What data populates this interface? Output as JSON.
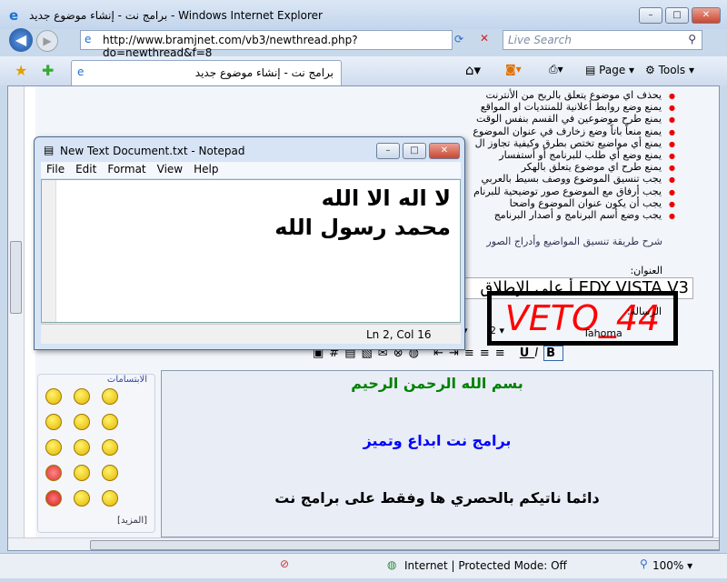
{
  "window": {
    "title": "برامج نت - إنشاء موضوع جديد - Windows Internet Explorer"
  },
  "nav": {
    "url": "http://www.bramjnet.com/vb3/newthread.php?do=newthread&f=8",
    "search_placeholder": "Live Search"
  },
  "tab": {
    "label": "برامج نت - إنشاء موضوع جديد"
  },
  "commands": {
    "page": "Page",
    "tools": "Tools"
  },
  "rules": [
    "يحذف اي موضوع يتعلق بالربح من الأنترنت",
    "يمنع وضع روابط أعلانية للمنتديات او المواقع",
    "يمنع طرح موضوعين في القسم بنفس الوقت",
    "يمنع منعاً باتاً وضع زخارف في عنوان الموضوع",
    "يمنع أي مواضيع تختص بطرق وكيفية تجاوز ال",
    "يمنع وضع أي طلب للبرنامج أو أستفسار",
    "يمنع طرح اي موضوع يتعلق بالهكر",
    "يجب تنسيق الموضوع ووصف بسيط بالعربي",
    "يجب أرفاق مع الموضوع صور توضيحية للبرنام",
    "يجب أن يكون عنوان الموضوع واضحا",
    "يجب وضع أسم البرنامج و أصدار البرنامج"
  ],
  "rules_link": "شرح طريقة تنسيق المواضيع وأدراج الصور",
  "form": {
    "title_label": "العنوان:",
    "title_value": "EDY VISTA V3 أ على الإطلاق",
    "message_label": "الرسالة:",
    "font_name": "Tahoma",
    "font_size": "2"
  },
  "notepad": {
    "title": "New Text Document.txt - Notepad",
    "menu": [
      "File",
      "Edit",
      "Format",
      "View",
      "Help"
    ],
    "lines": [
      "لا اله الا الله",
      "محمد رسول الله"
    ],
    "status": "Ln 2, Col 16"
  },
  "watermark": "VETO_44",
  "smilies": {
    "title": "الابتسامات",
    "more": "[المزيد]"
  },
  "editor": {
    "lines": [
      {
        "text": "بسم الله الرحمن الرحيم",
        "color": "#008000"
      },
      {
        "text": "برامج نت ابداع وتميز",
        "color": "#0000ff"
      },
      {
        "text": "دائما ناتيكم بالحصري ها وفقط على برامج نت",
        "color": "#000000"
      }
    ]
  },
  "status": {
    "zone": "Internet | Protected Mode: Off",
    "zoom": "100%"
  }
}
